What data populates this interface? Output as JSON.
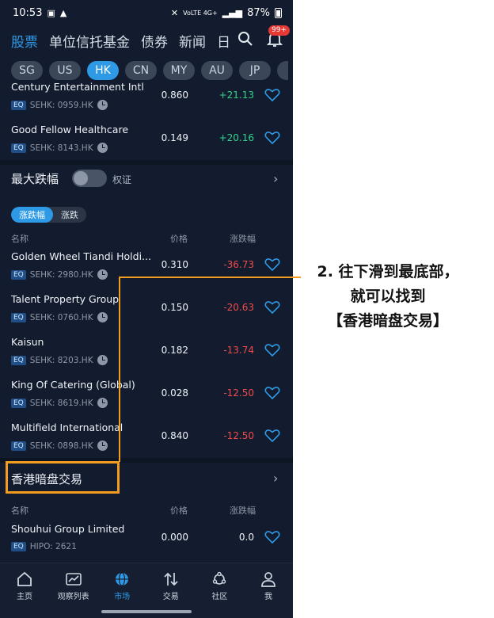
{
  "status_bar": {
    "time": "10:53",
    "network": "VoLTE 4G+",
    "battery": "87%"
  },
  "top_tabs": [
    {
      "label": "股票",
      "active": true
    },
    {
      "label": "单位信托基金",
      "active": false
    },
    {
      "label": "债券",
      "active": false
    },
    {
      "label": "新闻",
      "active": false
    },
    {
      "label": "日",
      "active": false
    }
  ],
  "notification_badge": "99+",
  "markets": [
    {
      "label": "SG",
      "active": false
    },
    {
      "label": "US",
      "active": false
    },
    {
      "label": "HK",
      "active": true
    },
    {
      "label": "CN",
      "active": false
    },
    {
      "label": "MY",
      "active": false
    },
    {
      "label": "AU",
      "active": false
    },
    {
      "label": "JP",
      "active": false
    }
  ],
  "gainers_rows": [
    {
      "name": "Century Entertainment Intl",
      "tag": "EQ",
      "code": "SEHK: 0959.HK",
      "price": "0.860",
      "change": "+21.13"
    },
    {
      "name": "Good Fellow Healthcare",
      "tag": "EQ",
      "code": "SEHK: 8143.HK",
      "price": "0.149",
      "change": "+20.16"
    }
  ],
  "losers_section": {
    "title": "最大跌幅",
    "toggle_label": "权证",
    "toggle_on": false,
    "segments": [
      {
        "label": "涨跌幅",
        "active": true
      },
      {
        "label": "涨跌",
        "active": false
      }
    ],
    "col_name": "名称",
    "col_price": "价格",
    "col_change": "涨跌幅",
    "rows": [
      {
        "name": "Golden Wheel Tiandi Holdi...",
        "tag": "EQ",
        "code": "SEHK: 2980.HK",
        "price": "0.310",
        "change": "-36.73"
      },
      {
        "name": "Talent Property Group",
        "tag": "EQ",
        "code": "SEHK: 0760.HK",
        "price": "0.150",
        "change": "-20.63"
      },
      {
        "name": "Kaisun",
        "tag": "EQ",
        "code": "SEHK: 8203.HK",
        "price": "0.182",
        "change": "-13.74"
      },
      {
        "name": "King Of Catering (Global)",
        "tag": "EQ",
        "code": "SEHK: 8619.HK",
        "price": "0.028",
        "change": "-12.50"
      },
      {
        "name": "Multifield International",
        "tag": "EQ",
        "code": "SEHK: 0898.HK",
        "price": "0.840",
        "change": "-12.50"
      }
    ]
  },
  "grey_section": {
    "title": "香港暗盘交易",
    "col_name": "名称",
    "col_price": "价格",
    "col_change": "涨跌幅",
    "rows": [
      {
        "name": "Shouhui Group Limited",
        "tag": "EQ",
        "code": "HIPO: 2621",
        "price": "0.000",
        "change": "0.0"
      }
    ]
  },
  "bottom_nav": [
    {
      "label": "主页",
      "icon": "home-icon",
      "active": false
    },
    {
      "label": "观察列表",
      "icon": "chart-icon",
      "active": false
    },
    {
      "label": "市场",
      "icon": "globe-icon",
      "active": true
    },
    {
      "label": "交易",
      "icon": "arrows-icon",
      "active": false
    },
    {
      "label": "社区",
      "icon": "community-icon",
      "active": false
    },
    {
      "label": "我",
      "icon": "person-icon",
      "active": false
    }
  ],
  "annotation": {
    "lines": [
      "2. 往下滑到最底部，",
      "就可以找到",
      "【香港暗盘交易】"
    ],
    "color": "#f39c1f"
  },
  "colors": {
    "accent": "#2e9ae6",
    "up": "#2fd48a",
    "down": "#f04a4a",
    "background": "#131c2e"
  }
}
